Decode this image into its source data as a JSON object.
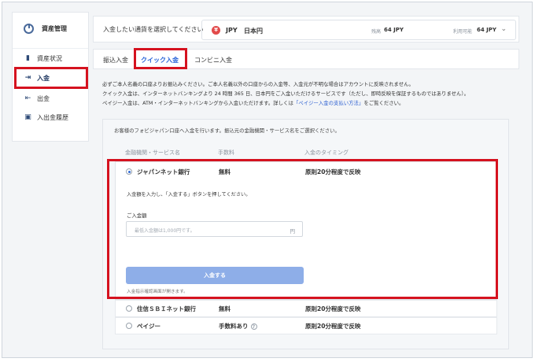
{
  "sidebar": {
    "title": "資産管理",
    "items": [
      {
        "label": "資産状況",
        "icon": "bar-chart-icon"
      },
      {
        "label": "入金",
        "icon": "deposit-arrow-icon",
        "active": true
      },
      {
        "label": "出金",
        "icon": "withdraw-arrow-icon"
      },
      {
        "label": "入出金履歴",
        "icon": "history-icon"
      }
    ]
  },
  "topbar": {
    "prompt": "入金したい通貨を選択してください",
    "currency_badge": "¥",
    "currency_code": "JPY",
    "currency_name": "日本円",
    "balance_label": "残高",
    "balance_value": "64 JPY",
    "available_label": "利用可能",
    "available_value": "64 JPY"
  },
  "tabs": [
    {
      "label": "振込入金"
    },
    {
      "label": "クイック入金",
      "active": true
    },
    {
      "label": "コンビニ入金"
    }
  ],
  "info": {
    "line1": "必ずご本人名義の口座よりお振込みください。ご本人名義以外の口座からの入金等、入金元が不明な場合はアカウントに反映されません。",
    "line2": "クイック入金は、インターネットバンキングより 24 時間 365 日、日本円をご入金いただけるサービスです（ただし、即時反映を保証するものではありません）。",
    "line3_pre": "ペイジー入金は、ATM・インターネットバンキングから入金いただけます。詳しくは",
    "line3_link": "「ペイジー入金の支払い方法」",
    "line3_post": "をご覧ください。"
  },
  "panel": {
    "note": "お客様のフォビジャパン口座へ入金を行います。振込元の金融機関・サービス名をご選択ください。",
    "columns": [
      "金融機関・サービス名",
      "手数料",
      "入金のタイミング"
    ],
    "selected": {
      "name": "ジャパンネット銀行",
      "fee": "無料",
      "timing": "原則20分程度で反映"
    },
    "instruction": "入金額を入力し、「入金する」ボタンを押してください。",
    "amount_label": "ご入金額",
    "amount_placeholder": "最低入金額は1,000円です。",
    "amount_unit": "円",
    "submit_label": "入金する",
    "submit_note": "入金指示確認画面が開きます。",
    "others": [
      {
        "name": "住信ＳＢＩネット銀行",
        "fee": "無料",
        "timing": "原則20分程度で反映"
      },
      {
        "name": "ペイジー",
        "fee": "手数料あり",
        "fee_icon": "?",
        "timing": "原則20分程度で反映"
      }
    ]
  },
  "colors": {
    "accent": "#2863d8",
    "highlight": "#d5121f",
    "submit_disabled": "#8eaee8"
  }
}
